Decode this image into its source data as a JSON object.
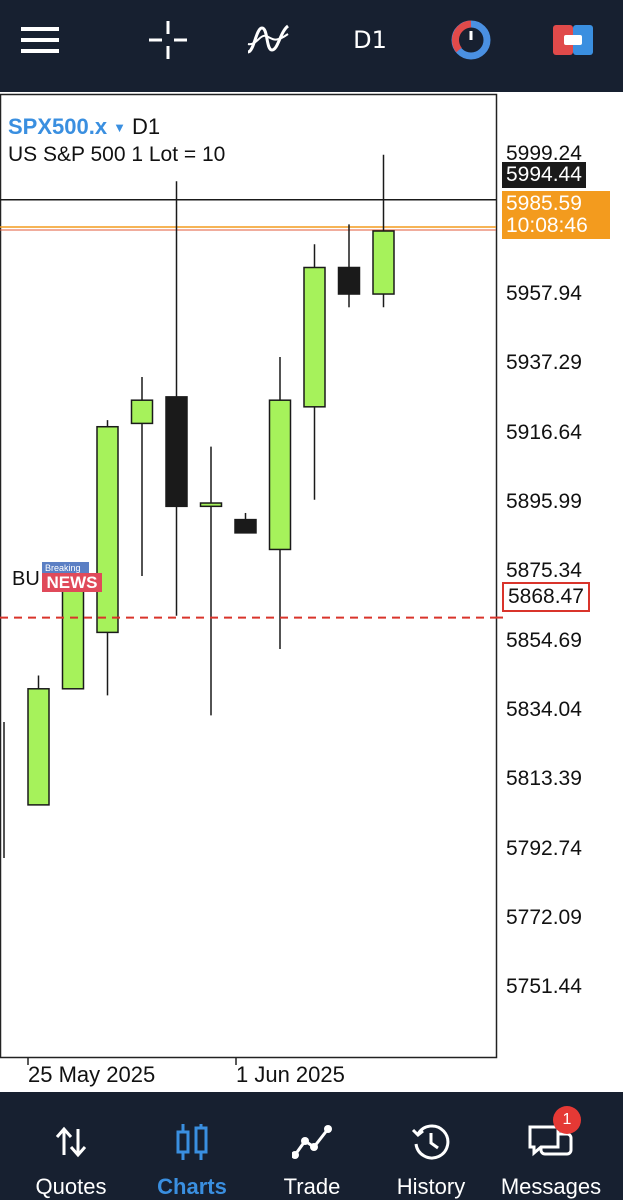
{
  "toolbar": {
    "menu_icon": "hamburger-menu-icon",
    "crosshair_icon": "crosshair-icon",
    "indicators_icon": "indicators-icon",
    "timeframe": "D1",
    "timer_icon": "timer-icon",
    "trade_icon": "one-click-trade-icon"
  },
  "chart_header": {
    "symbol": "SPX500.x",
    "caret": "▼",
    "timeframe": "D1",
    "description": "US S&P 500 1 Lot = 10"
  },
  "price_axis": {
    "ticks": [
      "5999.24",
      "5957.94",
      "5937.29",
      "5916.64",
      "5895.99",
      "5875.34",
      "5854.69",
      "5834.04",
      "5813.39",
      "5792.74",
      "5772.09",
      "5751.44"
    ]
  },
  "bid_price": "5994.44",
  "ask_price": "5985.59",
  "candle_timer": "10:08:46",
  "price_level": {
    "label": "5868.47",
    "value": 5868.47,
    "color": "#d9342b"
  },
  "news_marker": {
    "prefix": "BU",
    "top": "Breaking",
    "main": "NEWS"
  },
  "time_axis": {
    "labels": [
      "25 May 2025",
      "1 Jun 2025"
    ]
  },
  "colors": {
    "bull": "#a6f25b",
    "bear": "#1a1a1a",
    "bid_line": "#1a1a1a",
    "ask_line": "#f39b1e",
    "accent": "#3a8fe0",
    "bar_bg": "#172030"
  },
  "chart_data": {
    "type": "candlestick",
    "ylim": [
      5736,
      6026
    ],
    "candles": [
      {
        "open": 5812,
        "high": 5837,
        "low": 5796,
        "close": 5830,
        "partial": true
      },
      {
        "open": 5812,
        "high": 5851,
        "low": 5812,
        "close": 5847
      },
      {
        "open": 5847,
        "high": 5885,
        "low": 5847,
        "close": 5879
      },
      {
        "open": 5864,
        "high": 5928,
        "low": 5845,
        "close": 5926
      },
      {
        "open": 5927,
        "high": 5941,
        "low": 5881,
        "close": 5934
      },
      {
        "open": 5935,
        "high": 6000,
        "low": 5869,
        "close": 5902
      },
      {
        "open": 5902,
        "high": 5920,
        "low": 5839,
        "close": 5903
      },
      {
        "open": 5898,
        "high": 5900,
        "low": 5894,
        "close": 5894
      },
      {
        "open": 5889,
        "high": 5947,
        "low": 5859,
        "close": 5934
      },
      {
        "open": 5932,
        "high": 5981,
        "low": 5904,
        "close": 5974
      },
      {
        "open": 5974,
        "high": 5987,
        "low": 5962,
        "close": 5966
      },
      {
        "open": 5966,
        "high": 6008,
        "low": 5962,
        "close": 5985
      }
    ]
  },
  "navbar": {
    "items": [
      {
        "label": "Quotes",
        "icon": "quotes-arrows-icon"
      },
      {
        "label": "Charts",
        "icon": "charts-candles-icon"
      },
      {
        "label": "Trade",
        "icon": "trade-line-icon"
      },
      {
        "label": "History",
        "icon": "history-clock-icon"
      },
      {
        "label": "Messages",
        "icon": "messages-chat-icon",
        "badge": "1"
      }
    ]
  }
}
